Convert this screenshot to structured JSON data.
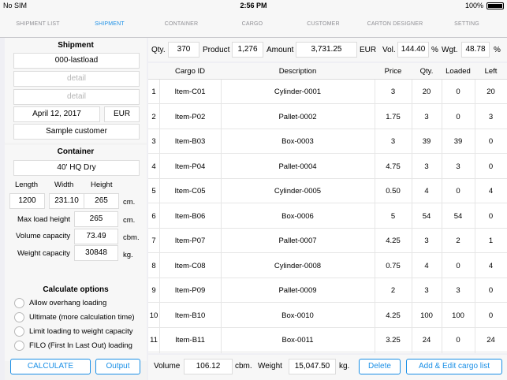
{
  "status": {
    "carrier": "No SIM",
    "time": "2:56 PM",
    "battery": "100%"
  },
  "tabs": [
    "SHIPMENT LIST",
    "SHIPMENT",
    "CONTAINER",
    "CARGO",
    "CUSTOMER",
    "CARTON DESIGNER",
    "SETTING"
  ],
  "active_tab": "SHIPMENT",
  "shipment": {
    "title": "Shipment",
    "name": "000-lastload",
    "detail1_placeholder": "detail",
    "detail2_placeholder": "detail",
    "date": "April 12, 2017",
    "currency": "EUR",
    "customer": "Sample customer"
  },
  "container": {
    "title": "Container",
    "type": "40' HQ Dry",
    "length_label": "Length",
    "width_label": "Width",
    "height_label": "Height",
    "length": "1200",
    "width": "231.10",
    "height": "265",
    "dim_unit": "cm.",
    "max_load_label": "Max load height",
    "max_load": "265",
    "max_load_unit": "cm.",
    "volume_label": "Volume capacity",
    "volume": "73.49",
    "volume_unit": "cbm.",
    "weight_label": "Weight capacity",
    "weight": "30848",
    "weight_unit": "kg."
  },
  "options": {
    "title": "Calculate options",
    "items": [
      "Allow overhang loading",
      "Ultimate (more calculation time)",
      "Limit loading to weight capacity",
      "FILO (First In Last Out) loading"
    ]
  },
  "buttons": {
    "calculate": "CALCULATE",
    "output": "Output",
    "delete": "Delete",
    "add_edit": "Add & Edit cargo list"
  },
  "summary": {
    "qty_label": "Qty.",
    "qty": "370",
    "product_label": "Product",
    "product": "1,276",
    "amount_label": "Amount",
    "amount": "3,731.25",
    "currency": "EUR",
    "vol_label": "Vol.",
    "vol": "144.40",
    "vol_unit": "%",
    "wgt_label": "Wgt.",
    "wgt": "48.78",
    "wgt_unit": "%"
  },
  "table": {
    "headers": [
      "Cargo ID",
      "Description",
      "Price",
      "Qty.",
      "Loaded",
      "Left"
    ],
    "rows": [
      [
        "1",
        "Item-C01",
        "Cylinder-0001",
        "3",
        "20",
        "0",
        "20"
      ],
      [
        "2",
        "Item-P02",
        "Pallet-0002",
        "1.75",
        "3",
        "0",
        "3"
      ],
      [
        "3",
        "Item-B03",
        "Box-0003",
        "3",
        "39",
        "39",
        "0"
      ],
      [
        "4",
        "Item-P04",
        "Pallet-0004",
        "4.75",
        "3",
        "3",
        "0"
      ],
      [
        "5",
        "Item-C05",
        "Cylinder-0005",
        "0.50",
        "4",
        "0",
        "4"
      ],
      [
        "6",
        "Item-B06",
        "Box-0006",
        "5",
        "54",
        "54",
        "0"
      ],
      [
        "7",
        "Item-P07",
        "Pallet-0007",
        "4.25",
        "3",
        "2",
        "1"
      ],
      [
        "8",
        "Item-C08",
        "Cylinder-0008",
        "0.75",
        "4",
        "0",
        "4"
      ],
      [
        "9",
        "Item-P09",
        "Pallet-0009",
        "2",
        "3",
        "3",
        "0"
      ],
      [
        "10",
        "Item-B10",
        "Box-0010",
        "4.25",
        "100",
        "100",
        "0"
      ],
      [
        "11",
        "Item-B11",
        "Box-0011",
        "3.25",
        "24",
        "0",
        "24"
      ]
    ]
  },
  "footer": {
    "volume_label": "Volume",
    "volume": "106.12",
    "volume_unit": "cbm.",
    "weight_label": "Weight",
    "weight": "15,047.50",
    "weight_unit": "kg."
  }
}
